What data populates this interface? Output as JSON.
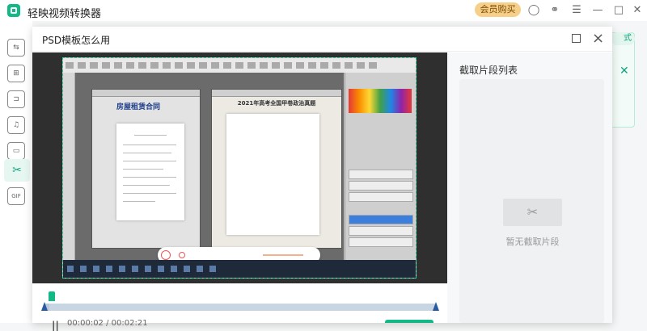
{
  "app": {
    "title": "轻映视频转换器",
    "vip_label": "会员购买",
    "accent_color": "#12b886"
  },
  "titlebar_icons": [
    "user-icon",
    "headset-icon",
    "menu-icon",
    "minimize-icon",
    "maximize-icon",
    "close-icon"
  ],
  "background": {
    "pill_text": "式"
  },
  "nav": {
    "items": [
      {
        "name": "nav-convert",
        "icon": "convert-icon",
        "glyph": "⇆"
      },
      {
        "name": "nav-compress",
        "icon": "compress-icon",
        "glyph": "⊞"
      },
      {
        "name": "nav-merge",
        "icon": "merge-icon",
        "glyph": "⊐"
      },
      {
        "name": "nav-audio",
        "icon": "audio-icon",
        "glyph": "♫"
      },
      {
        "name": "nav-subtitle",
        "icon": "subtitle-icon",
        "glyph": "▭"
      },
      {
        "name": "nav-cut",
        "icon": "scissors-icon",
        "glyph": "✂"
      },
      {
        "name": "nav-gif",
        "icon": "gif-icon",
        "glyph": "GIF"
      }
    ]
  },
  "modal": {
    "title": "PSD模板怎么用",
    "video": {
      "doc_a_title": "房屋租赁合同",
      "doc_b_title": "2021年高考全国甲卷政治真题"
    },
    "clip_list": {
      "title": "截取片段列表",
      "empty_text": "暂无截取片段"
    },
    "player": {
      "time": "00:00:02 / 00:02:21",
      "progress_fraction": 0.014
    }
  }
}
